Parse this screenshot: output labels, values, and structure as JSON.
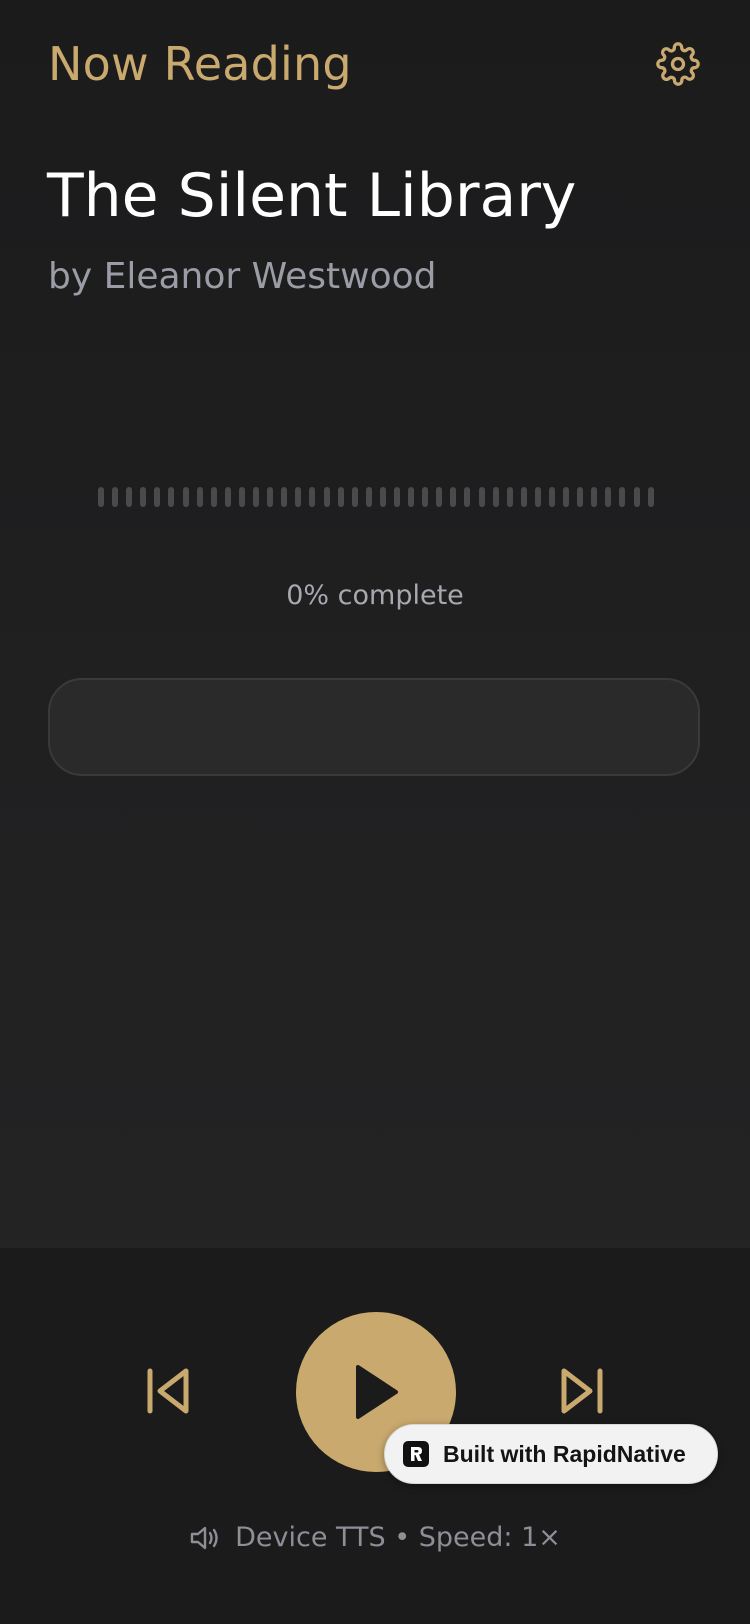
{
  "header": {
    "title": "Now Reading",
    "settings_icon": "gear-icon"
  },
  "book": {
    "title": "The Silent Library",
    "author": "by Eleanor Westwood"
  },
  "progress": {
    "label": "0% complete",
    "value": 0
  },
  "controls": {
    "previous_icon": "skip-previous-icon",
    "play_icon": "play-icon",
    "next_icon": "skip-next-icon"
  },
  "tts": {
    "icon": "speaker-icon",
    "label": "Device TTS • Speed: 1×"
  },
  "badge": {
    "label": "Built with RapidNative",
    "logo_letter": "R"
  },
  "colors": {
    "accent": "#c9a96e",
    "background": "#1c1c1d",
    "muted_text": "#9a9ca6"
  }
}
